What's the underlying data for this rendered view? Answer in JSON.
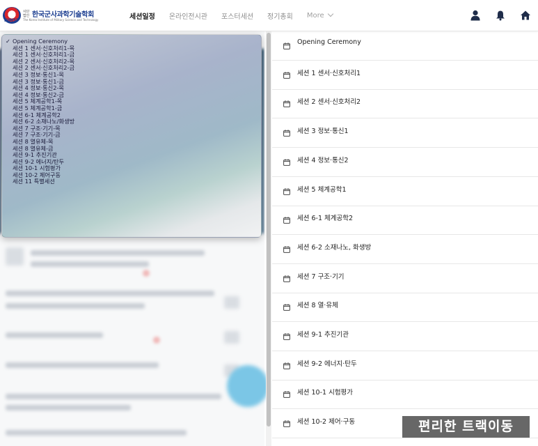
{
  "header": {
    "logo": {
      "org_name": "한국군사과학기술학회",
      "seal_text": "KIMST",
      "small_text": "사단 법인",
      "english_name": "The Korea Institute of Military Science and Technology"
    },
    "nav": [
      {
        "label": "세션일정",
        "active": true
      },
      {
        "label": "온라인전시관",
        "active": false
      },
      {
        "label": "포스터세션",
        "active": false
      },
      {
        "label": "정기총회",
        "active": false
      },
      {
        "label": "More",
        "active": false
      }
    ],
    "icons": [
      "user-icon",
      "bell-icon",
      "home-icon"
    ]
  },
  "dropdown": {
    "selected": "Opening Ceremony",
    "options": [
      "Opening Ceremony",
      "세션 1 센서·신호처리1-목",
      "세션 1 센서·신호처리1-금",
      "세션 2 센서·신호처리2-목",
      "세션 2 센서·신호처리2-금",
      "세션 3 정보·통신1-목",
      "세션 3 정보·통신1-금",
      "세션 4 정보·통신2-목",
      "세션 4 정보·통신2-금",
      "세션 5 체계공학1-목",
      "세션 5 체계공학1-금",
      "세션 6-1 체계공학2",
      "세션 6-2 소재나노/화생방",
      "세션 7 구조·기기-목",
      "세션 7 구조·기기-금",
      "세션 8 열유체-목",
      "세션 8 열유체-금",
      "세션 9-1 추진기관",
      "세션 9-2 에너지/탄두",
      "세션 10-1 시험평가",
      "세션 10-2 제어구동",
      "세션 11 특별세션"
    ]
  },
  "sessions": [
    "Opening Ceremony",
    "세션 1 센서·신호처리1",
    "세션 2 센서·신호처리2",
    "세션 3 정보·통신1",
    "세션 4 정보·통신2",
    "세션 5 체계공학1",
    "세션 6-1 체계공학2",
    "세션 6-2 소재나노, 화생방",
    "세션 7 구조·기기",
    "세션 8 열·유체",
    "세션 9-1 추진기관",
    "세션 9-2 에너지·탄두",
    "세션 10-1 시험평가",
    "세션 10-2 제어·구동",
    "세션 11 특별세션"
  ],
  "watermark": "편리한 트랙이동",
  "colors": {
    "accent": "#1d3f91",
    "nav_active": "#1a1a1a",
    "nav_inactive": "#8e8e8e",
    "row_border": "#e7e7e7",
    "watermark_bg": "#464646"
  }
}
